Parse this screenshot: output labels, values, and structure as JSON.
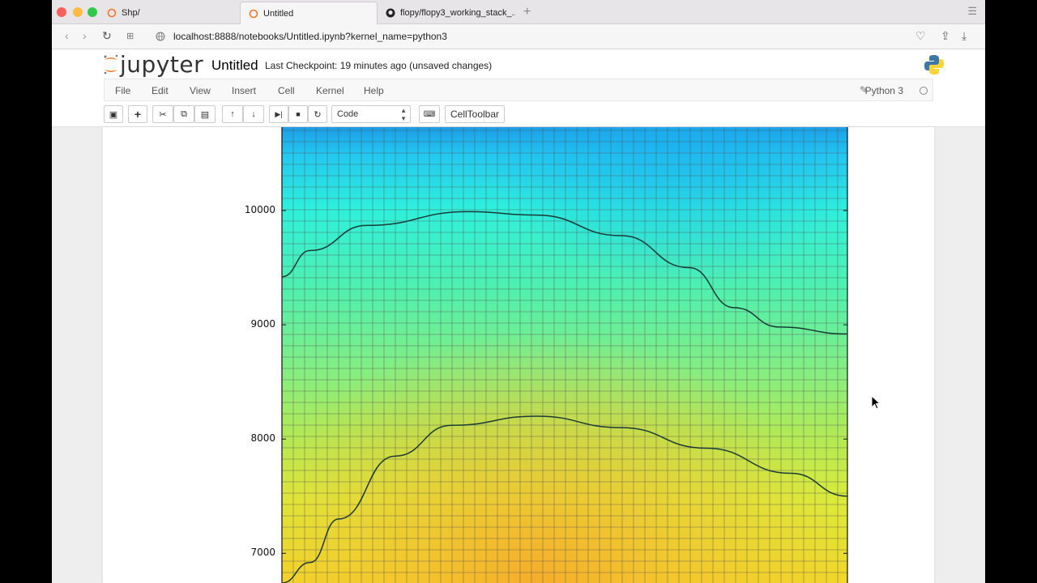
{
  "browser": {
    "tabs": [
      {
        "label": "Shp/",
        "active": false
      },
      {
        "label": "Untitled",
        "active": true
      },
      {
        "label": "flopy/flopy3_working_stack_...",
        "active": false
      }
    ],
    "url": "localhost:8888/notebooks/Untitled.ipynb?kernel_name=python3"
  },
  "jupyter": {
    "logo_text": "jupyter",
    "notebook_name": "Untitled",
    "checkpoint": "Last Checkpoint: 19 minutes ago (unsaved changes)",
    "menu": [
      "File",
      "Edit",
      "View",
      "Insert",
      "Cell",
      "Kernel",
      "Help"
    ],
    "kernel": "Python 3",
    "cell_type": "Code",
    "celltoolbar_label": "CellToolbar"
  },
  "chart_data": {
    "type": "heatmap",
    "title": "",
    "xlabel": "",
    "ylabel": "",
    "yticks": [
      "10000",
      "9000",
      "8000",
      "7000"
    ],
    "ytick_values": [
      10000,
      9000,
      8000,
      7000
    ],
    "ylim": [
      6740,
      10730
    ],
    "grid": true,
    "colormap": "jet",
    "contour_lines": [
      {
        "points": [
          [
            0,
            9420
          ],
          [
            0.05,
            9650
          ],
          [
            0.15,
            9870
          ],
          [
            0.33,
            9990
          ],
          [
            0.45,
            9960
          ],
          [
            0.6,
            9780
          ],
          [
            0.72,
            9500
          ],
          [
            0.8,
            9150
          ],
          [
            0.88,
            8980
          ],
          [
            1,
            8920
          ]
        ]
      },
      {
        "points": [
          [
            0,
            6740
          ],
          [
            0.05,
            6920
          ],
          [
            0.1,
            7300
          ],
          [
            0.2,
            7850
          ],
          [
            0.3,
            8120
          ],
          [
            0.45,
            8200
          ],
          [
            0.6,
            8100
          ],
          [
            0.75,
            7920
          ],
          [
            0.9,
            7700
          ],
          [
            1,
            7500
          ]
        ]
      }
    ]
  }
}
